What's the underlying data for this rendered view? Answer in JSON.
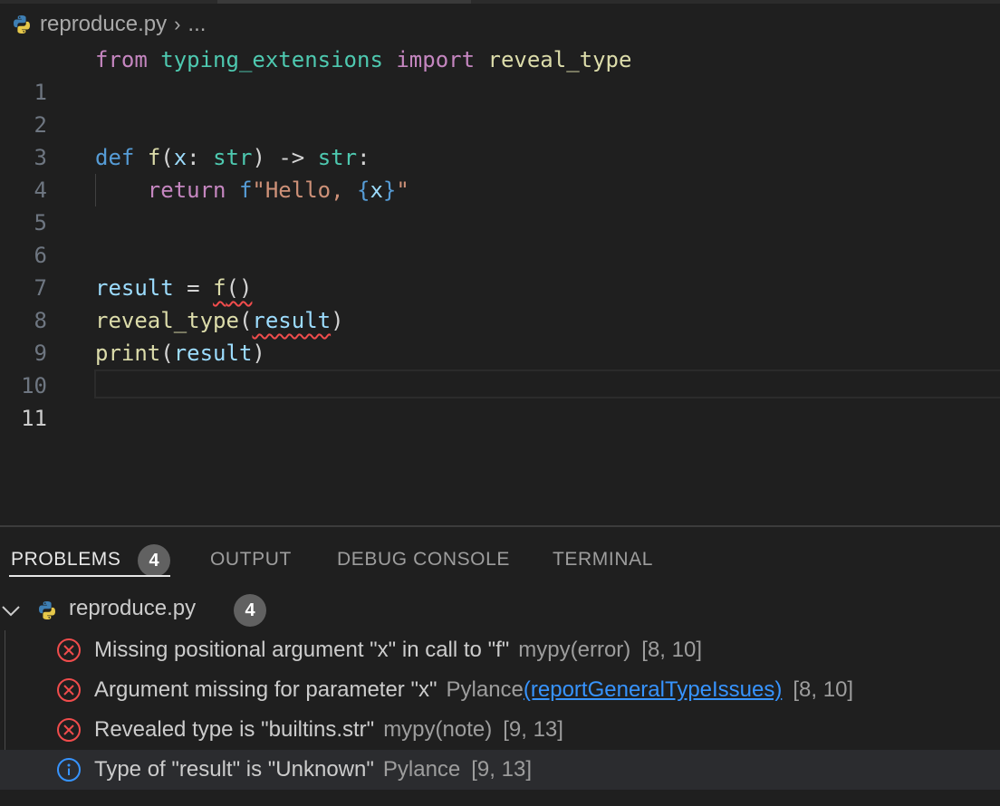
{
  "breadcrumb": {
    "file": "reproduce.py",
    "rest": "..."
  },
  "editor": {
    "line_numbers": [
      "1",
      "2",
      "3",
      "4",
      "5",
      "6",
      "7",
      "8",
      "9",
      "10",
      "11"
    ],
    "tokens": {
      "l1": [
        "from",
        "typing_extensions",
        "import",
        "reveal_type"
      ],
      "l4": [
        "def",
        "f",
        "(",
        "x",
        ":",
        "str",
        ")",
        "->",
        "str",
        ":"
      ],
      "l5": [
        "return",
        "f",
        "\"Hello, ",
        "{",
        "x",
        "}",
        "\""
      ],
      "l8": [
        "result",
        "=",
        "f",
        "()"
      ],
      "l9": [
        "reveal_type",
        "(",
        "result",
        ")"
      ],
      "l10": [
        "print",
        "(",
        "result",
        ")"
      ]
    }
  },
  "panel": {
    "tabs": [
      "PROBLEMS",
      "OUTPUT",
      "DEBUG CONSOLE",
      "TERMINAL"
    ],
    "problems_count": "4",
    "file": {
      "name": "reproduce.py",
      "count": "4"
    },
    "problems": [
      {
        "severity": "error",
        "message": "Missing positional argument \"x\" in call to \"f\"",
        "source": "mypy(error)",
        "position": "[8, 10]"
      },
      {
        "severity": "error",
        "message": "Argument missing for parameter \"x\"",
        "source": "Pylance",
        "link": "(reportGeneralTypeIssues)",
        "position": "[8, 10]"
      },
      {
        "severity": "error",
        "message": "Revealed type is \"builtins.str\"",
        "source": "mypy(note)",
        "position": "[9, 13]"
      },
      {
        "severity": "info",
        "message": "Type of \"result\" is \"Unknown\"",
        "source": "Pylance",
        "position": "[9, 13]"
      }
    ]
  },
  "colors": {
    "error": "#f14c4c",
    "info": "#3794ff",
    "link": "#3794ff"
  }
}
